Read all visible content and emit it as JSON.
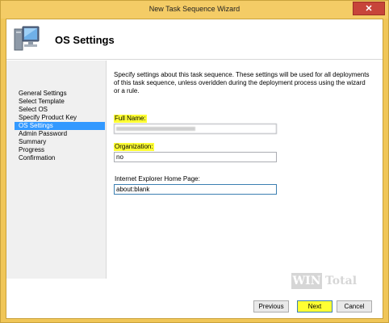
{
  "window": {
    "title": "New Task Sequence Wizard",
    "close_label": "✕"
  },
  "header": {
    "title": "OS Settings",
    "icon": "computer-monitor-icon"
  },
  "nav": {
    "items": [
      {
        "label": "General Settings",
        "active": false
      },
      {
        "label": "Select Template",
        "active": false
      },
      {
        "label": "Select OS",
        "active": false
      },
      {
        "label": "Specify Product Key",
        "active": false
      },
      {
        "label": "OS Settings",
        "active": true
      },
      {
        "label": "Admin Password",
        "active": false
      },
      {
        "label": "Summary",
        "active": false
      },
      {
        "label": "Progress",
        "active": false
      },
      {
        "label": "Confirmation",
        "active": false
      }
    ]
  },
  "main": {
    "description": "Specify settings about this task sequence.  These settings will be used for all deployments of this task sequence, unless overidden during the deployment process using the wizard or a rule.",
    "full_name_label": "Full Name:",
    "full_name_value": "",
    "organization_label": "Organization:",
    "organization_value": "no",
    "ie_home_label": "Internet Explorer Home Page:",
    "ie_home_value": "about:blank"
  },
  "watermark": {
    "brand_box": "WIN",
    "brand_text": "Total"
  },
  "footer": {
    "previous_label": "Previous",
    "next_label": "Next",
    "cancel_label": "Cancel"
  },
  "colors": {
    "frame": "#f0c658",
    "selection": "#3399ff",
    "highlight": "#ffff33"
  }
}
